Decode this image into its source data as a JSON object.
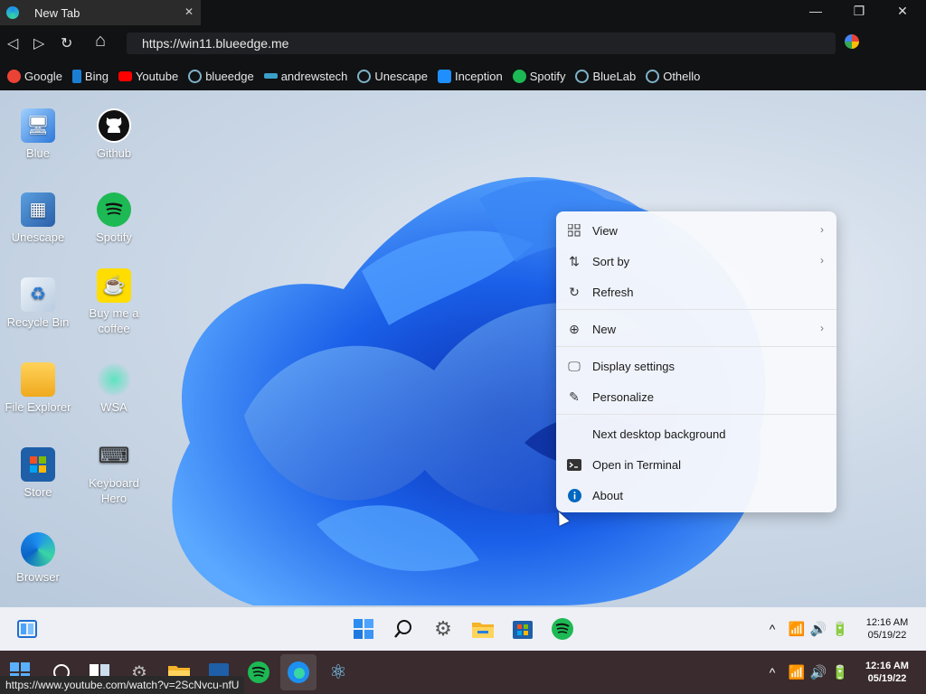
{
  "tab": {
    "title": "New Tab",
    "close": "✕"
  },
  "window_controls": {
    "minimize": "—",
    "maximize": "❐",
    "close": "✕"
  },
  "nav": {
    "back": "◁",
    "forward": "▷",
    "reload": "↻",
    "home": "⌂",
    "url": "https://win11.blueedge.me"
  },
  "bookmarks": [
    {
      "label": "Google",
      "color": "#ea4335"
    },
    {
      "label": "Bing",
      "color": "#1a7fd4"
    },
    {
      "label": "Youtube",
      "color": "#ff0000"
    },
    {
      "label": "blueedge",
      "color": "#7fb3c9"
    },
    {
      "label": "andrewstech",
      "color": "#3aa0c8"
    },
    {
      "label": "Unescape",
      "color": "#7fb3c9"
    },
    {
      "label": "Inception",
      "color": "#1f8fff"
    },
    {
      "label": "Spotify",
      "color": "#1db954"
    },
    {
      "label": "BlueLab",
      "color": "#7fb3c9"
    },
    {
      "label": "Othello",
      "color": "#7fb3c9"
    }
  ],
  "desktop_icons": [
    {
      "label": "Blue"
    },
    {
      "label": "Github"
    },
    {
      "label": "Unescape"
    },
    {
      "label": "Spotify"
    },
    {
      "label": "Recycle Bin"
    },
    {
      "label": "Buy me a coffee"
    },
    {
      "label": "File Explorer"
    },
    {
      "label": "WSA"
    },
    {
      "label": "Store"
    },
    {
      "label": "Keyboard Hero"
    },
    {
      "label": "Browser"
    }
  ],
  "context_menu": [
    {
      "label": "View",
      "icon": "grid-icon",
      "submenu": true
    },
    {
      "label": "Sort by",
      "icon": "sort-icon",
      "submenu": true
    },
    {
      "label": "Refresh",
      "icon": "refresh-icon",
      "submenu": false
    },
    {
      "label": "New",
      "icon": "plus-circle-icon",
      "submenu": true
    },
    {
      "label": "Display settings",
      "icon": "display-icon",
      "submenu": false
    },
    {
      "label": "Personalize",
      "icon": "pen-icon",
      "submenu": false
    },
    {
      "label": "Next desktop background",
      "icon": "",
      "submenu": false
    },
    {
      "label": "Open in Terminal",
      "icon": "terminal-icon",
      "submenu": false
    },
    {
      "label": "About",
      "icon": "info-icon",
      "submenu": false
    }
  ],
  "inner_taskbar": {
    "time": "12:16 AM",
    "date": "05/19/22"
  },
  "host_taskbar": {
    "time": "12:16 AM",
    "date": "05/19/22"
  },
  "status_url": "https://www.youtube.com/watch?v=2ScNvcu-nfU",
  "colors": {
    "accent": "#0067c0",
    "chrome": "#111214",
    "tab": "#2b2b2b"
  }
}
